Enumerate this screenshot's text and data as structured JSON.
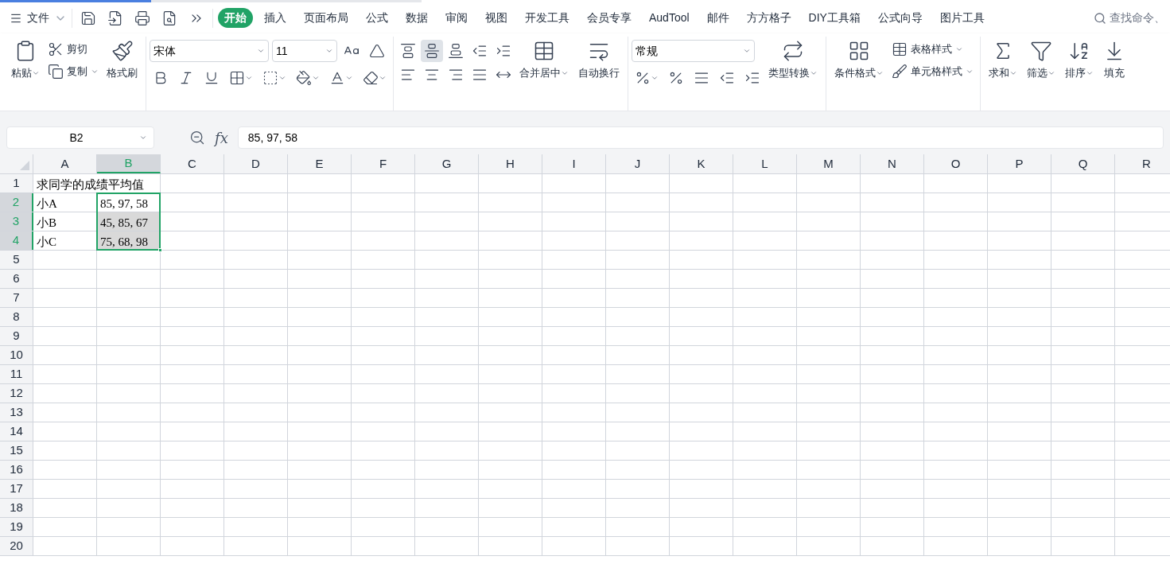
{
  "menu": {
    "file": "文件",
    "tabs": [
      {
        "label": "开始",
        "selected": true
      },
      {
        "label": "插入",
        "selected": false
      },
      {
        "label": "页面布局",
        "selected": false
      },
      {
        "label": "公式",
        "selected": false
      },
      {
        "label": "数据",
        "selected": false
      },
      {
        "label": "审阅",
        "selected": false
      },
      {
        "label": "视图",
        "selected": false
      },
      {
        "label": "开发工具",
        "selected": false
      },
      {
        "label": "会员专享",
        "selected": false
      },
      {
        "label": "AudTool",
        "selected": false
      },
      {
        "label": "邮件",
        "selected": false
      },
      {
        "label": "方方格子",
        "selected": false
      },
      {
        "label": "DIY工具箱",
        "selected": false
      },
      {
        "label": "公式向导",
        "selected": false
      },
      {
        "label": "图片工具",
        "selected": false
      }
    ],
    "search": {
      "placeholder": "查找命令、"
    }
  },
  "ribbon": {
    "clipboard": {
      "paste": "粘贴",
      "cut": "剪切",
      "copy": "复制",
      "painter": "格式刷"
    },
    "font": {
      "name": "宋体",
      "size": "11"
    },
    "alignment_buttons": [
      {
        "selected": false
      },
      {
        "selected": true
      },
      {
        "selected": false
      },
      {
        "selected": false
      },
      {
        "selected": false
      },
      {
        "selected": false
      },
      {
        "selected": false
      },
      {
        "selected": false
      },
      {
        "selected": false
      },
      {
        "selected": false
      }
    ],
    "alignment": {
      "merge": "合并居中",
      "wrap": "自动换行"
    },
    "number": {
      "format": "常规",
      "convert": "类型转换"
    },
    "styles": {
      "conditional": "条件格式",
      "table": "表格样式",
      "cell": "单元格样式"
    },
    "editing": {
      "sum": "求和",
      "filter": "筛选",
      "sort": "排序",
      "fill": "填充"
    }
  },
  "formula_bar": {
    "name_box": "B2",
    "function_label": "fx",
    "formula": "85, 97, 58"
  },
  "sheet": {
    "columns": [
      {
        "label": "A",
        "selected": false
      },
      {
        "label": "B",
        "selected": true
      },
      {
        "label": "C",
        "selected": false
      },
      {
        "label": "D",
        "selected": false
      },
      {
        "label": "E",
        "selected": false
      },
      {
        "label": "F",
        "selected": false
      },
      {
        "label": "G",
        "selected": false
      },
      {
        "label": "H",
        "selected": false
      },
      {
        "label": "I",
        "selected": false
      },
      {
        "label": "J",
        "selected": false
      },
      {
        "label": "K",
        "selected": false
      },
      {
        "label": "L",
        "selected": false
      },
      {
        "label": "M",
        "selected": false
      },
      {
        "label": "N",
        "selected": false
      },
      {
        "label": "O",
        "selected": false
      },
      {
        "label": "P",
        "selected": false
      },
      {
        "label": "Q",
        "selected": false
      },
      {
        "label": "R",
        "selected": false
      }
    ],
    "rows": [
      {
        "label": "1",
        "selected": false,
        "cells": [
          {
            "text": "求同学的成绩平均值",
            "selected": false
          }
        ]
      },
      {
        "label": "2",
        "selected": true,
        "cells": [
          {
            "text": "小A",
            "selected": false
          },
          {
            "text": "85, 97, 58",
            "selected": true,
            "active": true
          }
        ]
      },
      {
        "label": "3",
        "selected": true,
        "cells": [
          {
            "text": "小B",
            "selected": false
          },
          {
            "text": "45, 85, 67",
            "selected": true,
            "active": false
          }
        ]
      },
      {
        "label": "4",
        "selected": true,
        "cells": [
          {
            "text": "小C",
            "selected": false
          },
          {
            "text": "75, 68, 98",
            "selected": true,
            "active": false
          }
        ]
      },
      {
        "label": "5",
        "selected": false
      },
      {
        "label": "6",
        "selected": false
      },
      {
        "label": "7",
        "selected": false
      },
      {
        "label": "8",
        "selected": false
      },
      {
        "label": "9",
        "selected": false
      },
      {
        "label": "10",
        "selected": false
      },
      {
        "label": "11",
        "selected": false
      },
      {
        "label": "12",
        "selected": false
      },
      {
        "label": "13",
        "selected": false
      },
      {
        "label": "14",
        "selected": false
      },
      {
        "label": "15",
        "selected": false
      },
      {
        "label": "16",
        "selected": false
      },
      {
        "label": "17",
        "selected": false
      },
      {
        "label": "18",
        "selected": false
      },
      {
        "label": "19",
        "selected": false
      },
      {
        "label": "20",
        "selected": false
      }
    ]
  }
}
